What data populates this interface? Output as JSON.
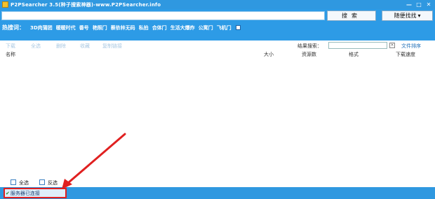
{
  "window": {
    "title": "P2PSearcher 3.5(种子搜索神器)-www.P2PSearcher.info",
    "min_symbol": "—",
    "max_symbol": "□",
    "close_symbol": "✕"
  },
  "search": {
    "value": "",
    "search_button": "搜索",
    "random_button": "随便找找",
    "random_arrow": "▾"
  },
  "hot_words": {
    "label": "热搜词：",
    "items": [
      "3D肉蒲团",
      "暖暖时代",
      "番号",
      "艳照门",
      "蔡依林无码",
      "私拍",
      "合体门",
      "生活大爆炸",
      "公寓门",
      "飞机门"
    ]
  },
  "toolbar": {
    "items": [
      "下载",
      "全选",
      "删除",
      "收藏",
      "复制链接"
    ],
    "result_search_label": "结果搜索：",
    "result_search_value": "",
    "clear_symbol": "×",
    "sort_link": "文件排序"
  },
  "columns": {
    "name": "名称",
    "size": "大小",
    "resources": "资源数",
    "format": "格式",
    "speed": "下载速度"
  },
  "selection": {
    "select_all": "全选",
    "invert": "反选"
  },
  "status": {
    "icon": "✔",
    "text": "服务器已连接"
  },
  "colors": {
    "titlebar": "#2f98e0",
    "band": "#2d9be6",
    "annotation": "#e02020"
  }
}
